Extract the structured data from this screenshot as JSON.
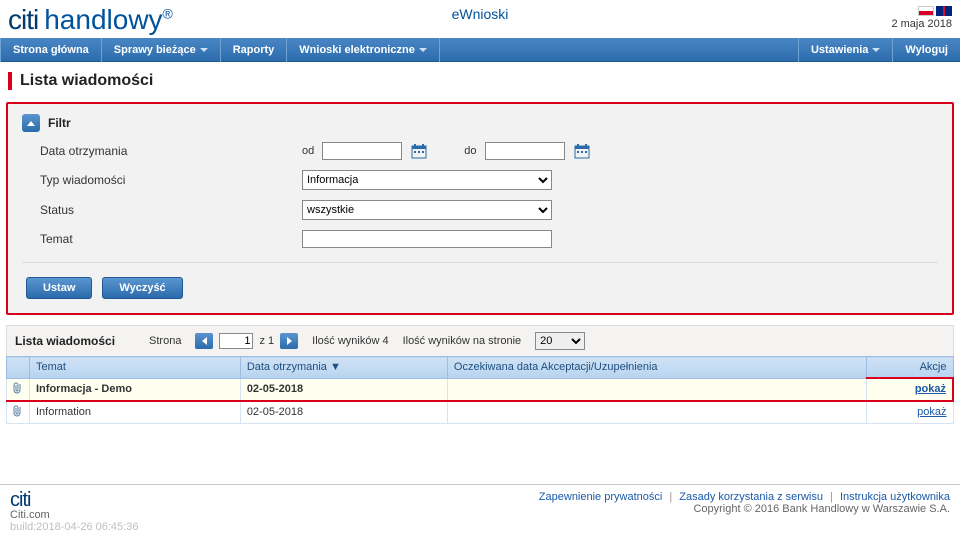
{
  "brand": {
    "citi": "citi",
    "arc": "",
    "handlowy": "handlowy",
    "reg": "®"
  },
  "app_title": "eWnioski",
  "date": "2 maja 2018",
  "nav": {
    "home": "Strona główna",
    "sprawy": "Sprawy bieżące",
    "raporty": "Raporty",
    "wnioski": "Wnioski elektroniczne",
    "ustawienia": "Ustawienia",
    "wyloguj": "Wyloguj"
  },
  "page_title": "Lista wiadomości",
  "filter": {
    "title": "Filtr",
    "data_label": "Data otrzymania",
    "od": "od",
    "do": "do",
    "typ_label": "Typ wiadomości",
    "typ_value": "Informacja",
    "status_label": "Status",
    "status_value": "wszystkie",
    "temat_label": "Temat",
    "ustaw": "Ustaw",
    "wyczysc": "Wyczyść"
  },
  "list": {
    "title": "Lista wiadomości",
    "strona_label": "Strona",
    "page": "1",
    "z": "z 1",
    "ilosc_wynikow": "Ilość wyników 4",
    "na_stronie_label": "Ilość wyników na stronie",
    "per_page": "20",
    "col_temat": "Temat",
    "col_data": "Data otrzymania ▼",
    "col_oczek": "Oczekiwana data Akceptacji/Uzupełnienia",
    "col_akcje": "Akcje",
    "rows": [
      {
        "temat": "Informacja - Demo",
        "data": "02-05-2018",
        "oczek": "",
        "akcja": "pokaż",
        "hl": true
      },
      {
        "temat": "Information",
        "data": "02-05-2018",
        "oczek": "",
        "akcja": "pokaż",
        "hl": false
      }
    ]
  },
  "footer": {
    "citi": "citi",
    "citicom": "Citi.com",
    "build": "build:2018-04-26 06:45:36",
    "priv": "Zapewnienie prywatności",
    "zasady": "Zasady korzystania z serwisu",
    "instr": "Instrukcja użytkownika",
    "copy": "Copyright © 2016 Bank Handlowy w Warszawie S.A."
  }
}
